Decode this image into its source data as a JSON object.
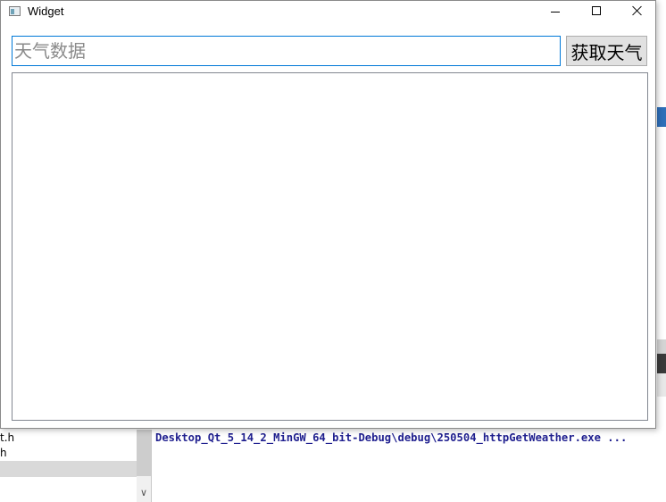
{
  "window": {
    "title": "Widget"
  },
  "search": {
    "placeholder": "天气数据",
    "value": ""
  },
  "toolbar": {
    "fetch_label": "获取天气"
  },
  "output": {
    "text": ""
  },
  "background": {
    "file_items": [
      "t.h",
      "h",
      ""
    ],
    "output_line": "Desktop_Qt_5_14_2_MinGW_64_bit-Debug\\debug\\250504_httpGetWeather.exe ...",
    "scroll_arrow": "∨"
  }
}
